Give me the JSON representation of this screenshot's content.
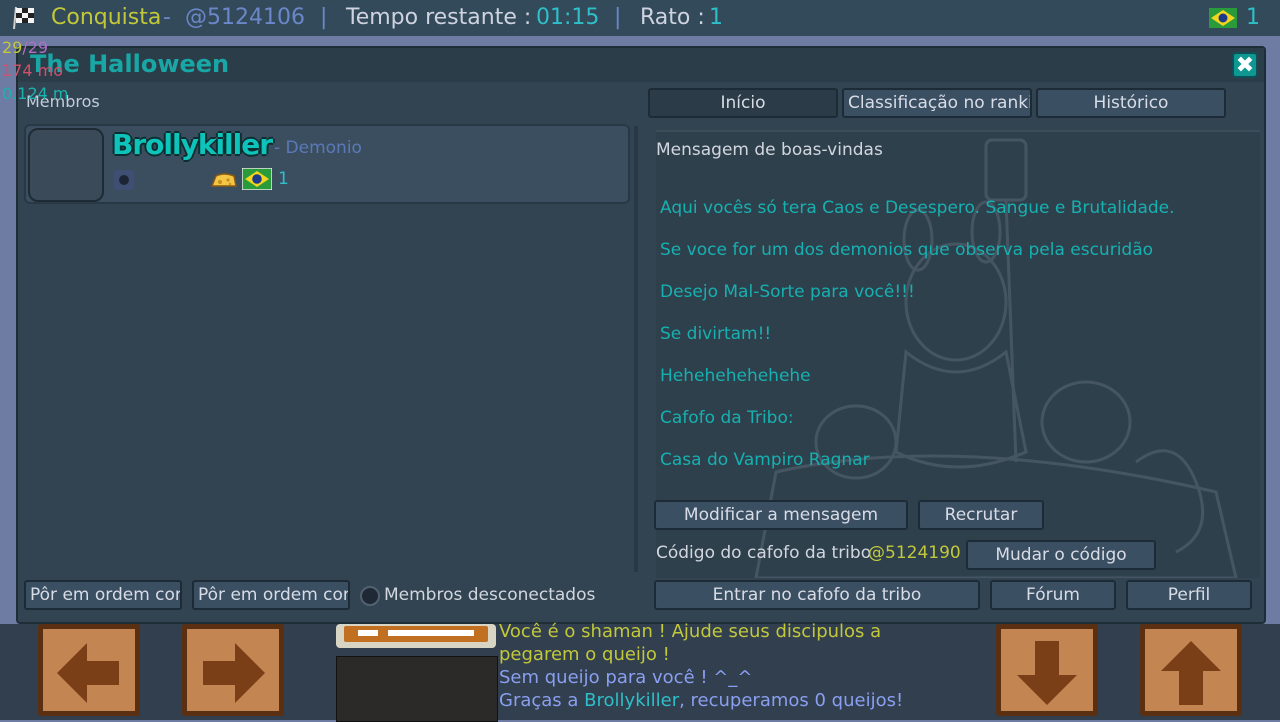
{
  "topbar": {
    "mode_label": "Conquista",
    "room_sep": " - ",
    "room_code": "@5124106",
    "divider": "|",
    "time_label": "Tempo restante : ",
    "time_value": "01:15",
    "rato_label": "Rato : ",
    "rato_value": "1",
    "player_count": "1",
    "flag": "brazil-flag-icon"
  },
  "stats": {
    "fps_a": "29",
    "fps_sep": "/",
    "fps_b": "29",
    "memory": "174 mo",
    "distance": "0.124 m"
  },
  "panel": {
    "title": "The Halloween",
    "close_label": "✖",
    "members_label": "Membros",
    "sort_button_1": "Pôr em ordem conf",
    "sort_button_2": "Pôr em ordem conf",
    "offline_members_label": "Membros desconectados"
  },
  "members": [
    {
      "name": "Brollykiller",
      "rank": "- Demonio",
      "cheese_count": "1"
    }
  ],
  "tabs": [
    {
      "label": "Início"
    },
    {
      "label": "Classificação no rankir"
    },
    {
      "label": "Histórico"
    }
  ],
  "welcome": {
    "title": "Mensagem de boas-vindas",
    "lines": [
      "Aqui vocês só tera Caos e Desespero. Sangue e Brutalidade.",
      "Se voce for um dos demonios que observa pela escuridão",
      "Desejo Mal-Sorte para você!!!",
      "Se divirtam!!",
      "Hehehehehehehe",
      "Cafofo da Tribo:",
      "Casa do Vampiro Ragnar"
    ]
  },
  "actions": {
    "modify_message": "Modificar a mensagem",
    "recruit": "Recrutar",
    "code_label": "Código do cafofo da tribo",
    "code_value": "@5124190",
    "change_code": "Mudar o código",
    "enter_house": "Entrar no cafofo da tribo",
    "forum": "Fórum",
    "profile": "Perfil"
  },
  "chat": {
    "line1": "Você é o shaman ! Ajude seus discipulos a",
    "line2": "pegarem o queijo !",
    "line3": "Sem queijo para você ! ^_^",
    "line4_a": "Graças a ",
    "line4_name": "Brollykiller",
    "line4_b": ", recuperamos 0 queijos!"
  },
  "colors": {
    "accent": "#18a7a5",
    "olive": "#c2c83a",
    "blue_text": "#6c87c9",
    "cyan_text": "#2ebfc8"
  }
}
